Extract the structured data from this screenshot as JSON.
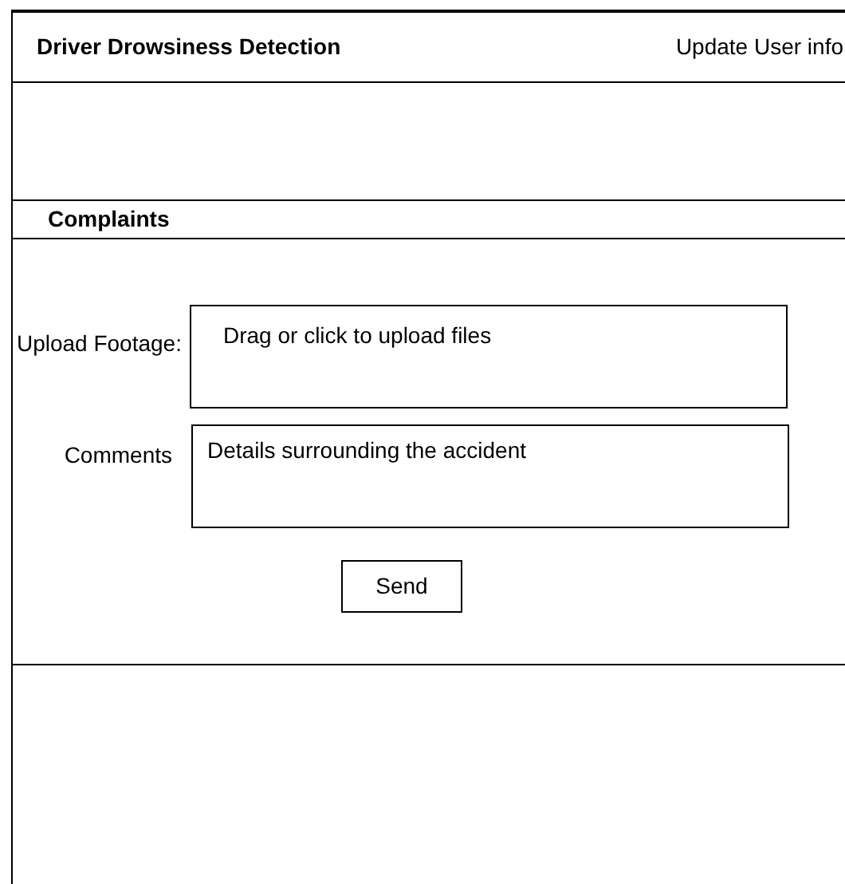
{
  "header": {
    "title": "Driver Drowsiness Detection",
    "link": "Update User info"
  },
  "section": {
    "title": "Complaints"
  },
  "form": {
    "upload": {
      "label": "Upload Footage:",
      "prompt": "Drag or click to upload files"
    },
    "comments": {
      "label": "Comments",
      "placeholder": "Details surrounding the accident"
    },
    "submit": "Send"
  }
}
